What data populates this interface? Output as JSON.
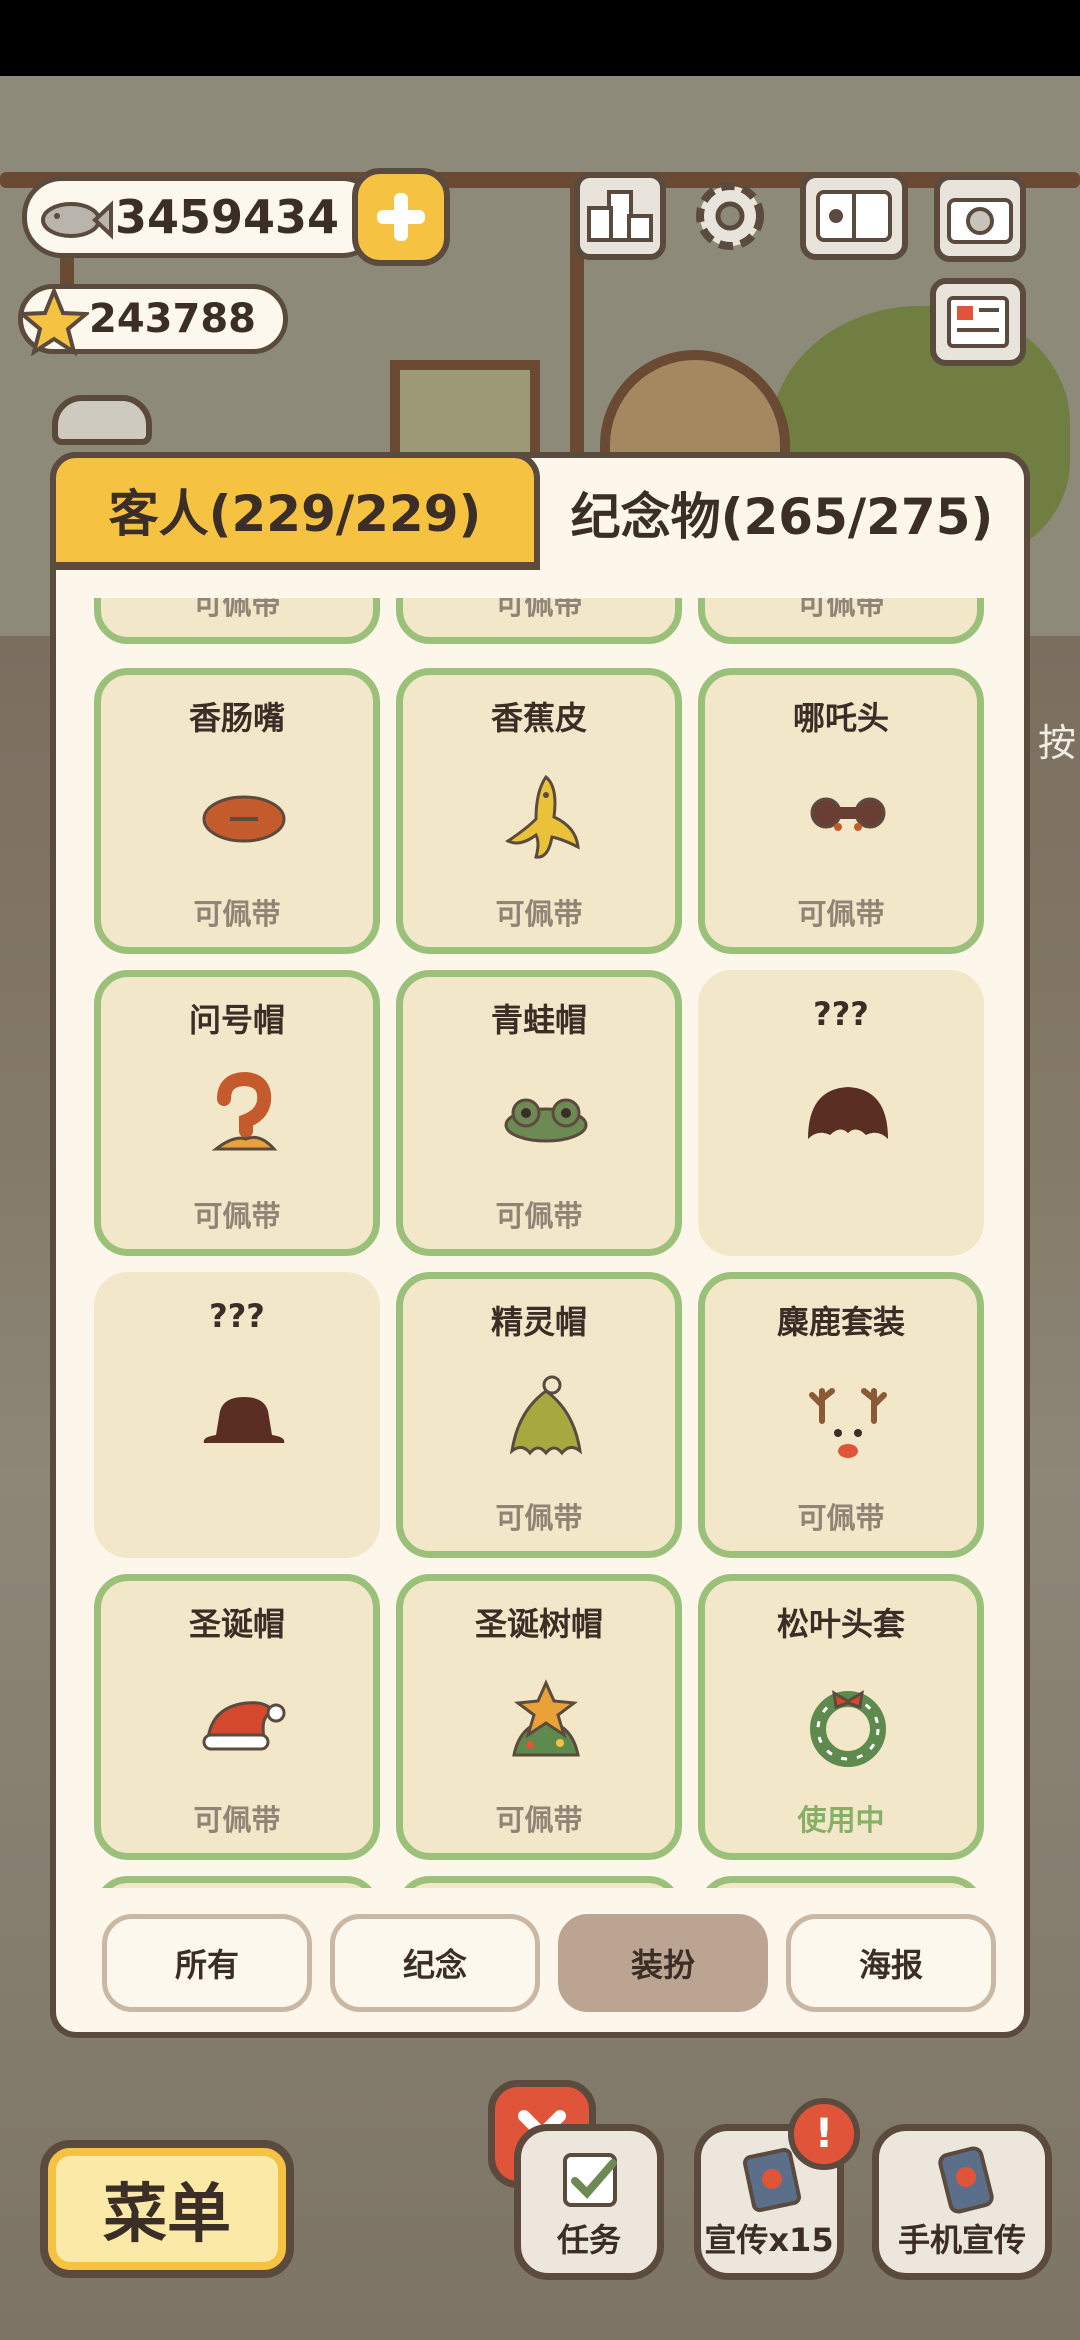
{
  "hud": {
    "fish_currency": "3459434",
    "star_currency": "243788"
  },
  "tabs": {
    "guests": "客人(229/229)",
    "souvenirs": "纪念物(265/275)"
  },
  "grid": {
    "partial_top_status": [
      "可佩带",
      "可佩带",
      "可佩带"
    ],
    "items": [
      {
        "name": "香肠嘴",
        "status": "可佩带",
        "icon": "sausage-mouth-icon",
        "locked": false
      },
      {
        "name": "香蕉皮",
        "status": "可佩带",
        "icon": "banana-peel-icon",
        "locked": false
      },
      {
        "name": "哪吒头",
        "status": "可佩带",
        "icon": "nezha-hair-icon",
        "locked": false
      },
      {
        "name": "问号帽",
        "status": "可佩带",
        "icon": "question-mark-hat-icon",
        "locked": false
      },
      {
        "name": "青蛙帽",
        "status": "可佩带",
        "icon": "frog-hat-icon",
        "locked": false
      },
      {
        "name": "???",
        "status": "",
        "icon": "unknown-hair-silhouette-icon",
        "locked": true
      },
      {
        "name": "???",
        "status": "",
        "icon": "unknown-hat-silhouette-icon",
        "locked": true
      },
      {
        "name": "精灵帽",
        "status": "可佩带",
        "icon": "elf-hat-icon",
        "locked": false
      },
      {
        "name": "麋鹿套装",
        "status": "可佩带",
        "icon": "reindeer-set-icon",
        "locked": false
      },
      {
        "name": "圣诞帽",
        "status": "可佩带",
        "icon": "santa-hat-icon",
        "locked": false
      },
      {
        "name": "圣诞树帽",
        "status": "可佩带",
        "icon": "christmas-tree-hat-icon",
        "locked": false
      },
      {
        "name": "松叶头套",
        "status": "使用中",
        "icon": "pine-wreath-icon",
        "locked": false
      }
    ]
  },
  "filters": [
    "所有",
    "纪念",
    "装扮",
    "海报"
  ],
  "active_filter": "装扮",
  "bottom": {
    "menu": "菜单",
    "tasks": "任务",
    "promote": "宣传x15",
    "phone_promote": "手机宣传",
    "alert": "!"
  },
  "side_hint": "按",
  "colors": {
    "accent_yellow": "#f5c242",
    "card_border_green": "#9bc07a",
    "in_use_green": "#86b064",
    "close_red": "#e0553a"
  }
}
